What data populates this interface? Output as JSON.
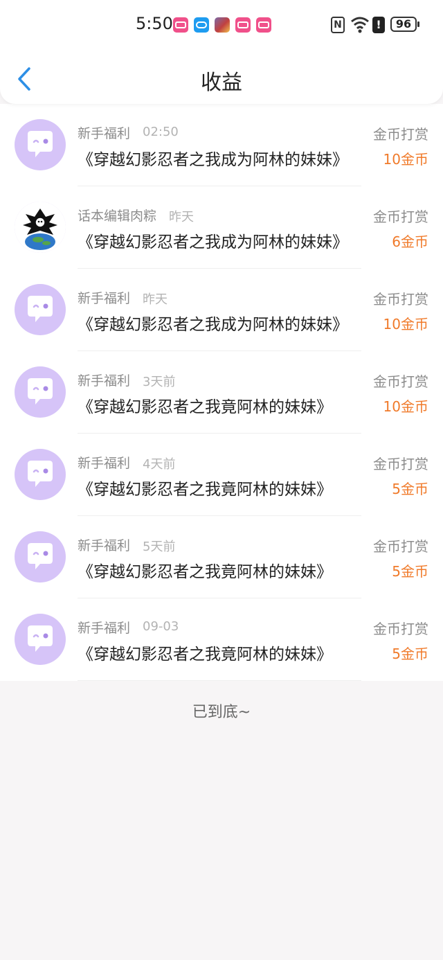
{
  "status_bar": {
    "time": "5:50",
    "nfc_label": "N",
    "battery": "96",
    "alert_symbol": "!"
  },
  "header": {
    "title": "收益",
    "back_icon": "chevron-left-icon"
  },
  "list": [
    {
      "sender": "新手福利",
      "when": "02:50",
      "book": "《穿越幻影忍者之我成为阿林的妹妹》",
      "type": "金币打赏",
      "amount": "10金币",
      "avatar": "chat-bubble-wink"
    },
    {
      "sender": "话本编辑肉粽",
      "when": "昨天",
      "book": "《穿越幻影忍者之我成为阿林的妹妹》",
      "type": "金币打赏",
      "amount": "6金币",
      "avatar": "earth-cartoon"
    },
    {
      "sender": "新手福利",
      "when": "昨天",
      "book": "《穿越幻影忍者之我成为阿林的妹妹》",
      "type": "金币打赏",
      "amount": "10金币",
      "avatar": "chat-bubble-wink"
    },
    {
      "sender": "新手福利",
      "when": "3天前",
      "book": "《穿越幻影忍者之我竟阿林的妹妹》",
      "type": "金币打赏",
      "amount": "10金币",
      "avatar": "chat-bubble-wink"
    },
    {
      "sender": "新手福利",
      "when": "4天前",
      "book": "《穿越幻影忍者之我竟阿林的妹妹》",
      "type": "金币打赏",
      "amount": "5金币",
      "avatar": "chat-bubble-wink"
    },
    {
      "sender": "新手福利",
      "when": "5天前",
      "book": "《穿越幻影忍者之我竟阿林的妹妹》",
      "type": "金币打赏",
      "amount": "5金币",
      "avatar": "chat-bubble-wink"
    },
    {
      "sender": "新手福利",
      "when": "09-03",
      "book": "《穿越幻影忍者之我竟阿林的妹妹》",
      "type": "金币打赏",
      "amount": "5金币",
      "avatar": "chat-bubble-wink"
    }
  ],
  "footer": {
    "end_text": "已到底~"
  },
  "colors": {
    "accent_blue": "#2d8fe6",
    "amount_orange": "#f07a2a",
    "avatar_purple": "#d6c4f8",
    "page_bg": "#f7f5f6"
  }
}
